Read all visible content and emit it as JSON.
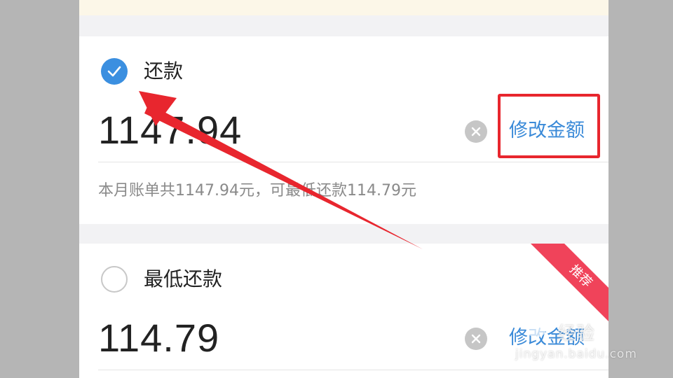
{
  "options": [
    {
      "label": "还款",
      "amount": "1147.94",
      "selected": true,
      "modify_label": "修改金额",
      "hint": "本月账单共1147.94元，可最低还款114.79元"
    },
    {
      "label": "最低还款",
      "amount": "114.79",
      "selected": false,
      "modify_label": "修改金额",
      "badge": "推荐"
    }
  ],
  "watermark": {
    "title": "经验",
    "url": "jingyan.baidu.com"
  },
  "colors": {
    "accent": "#3a8ad8",
    "checked": "#3b8fe0",
    "annotation": "#e8262e",
    "badge": "#f0435a"
  }
}
